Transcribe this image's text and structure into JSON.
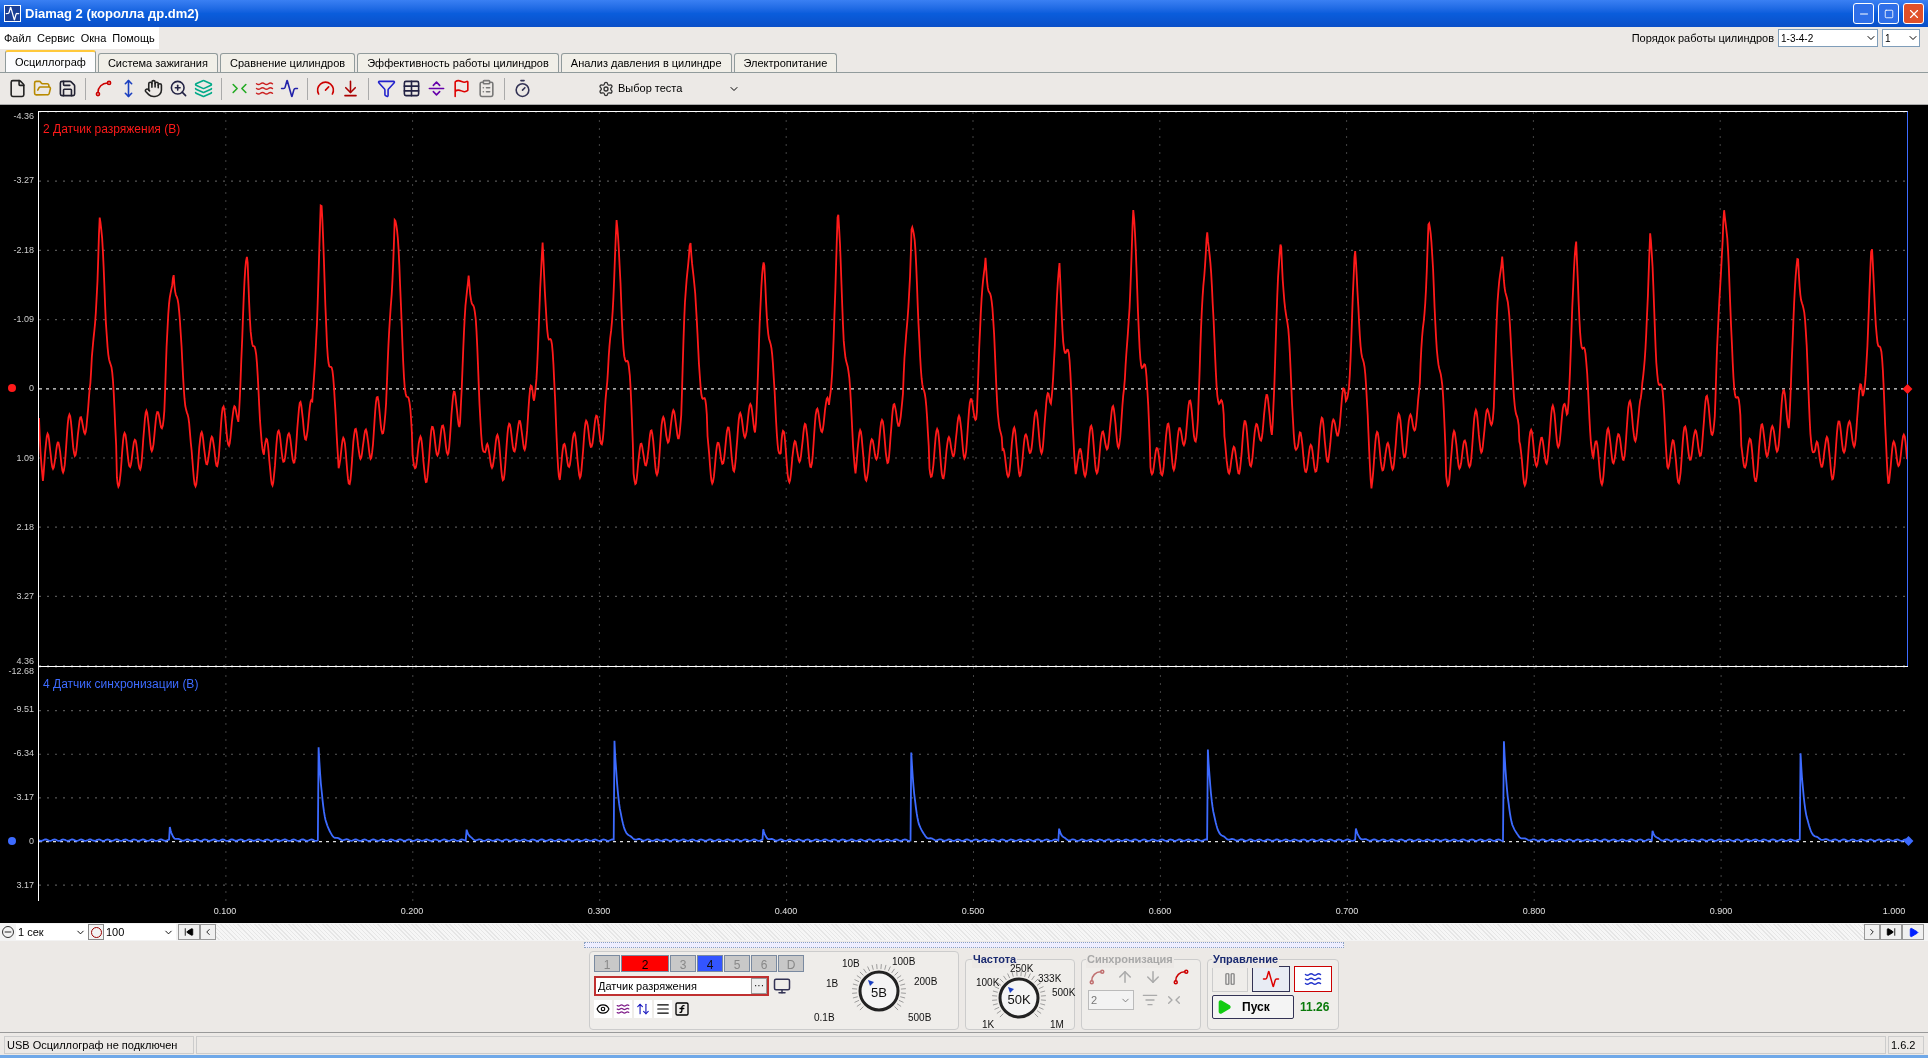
{
  "window": {
    "title": "Diamag 2 (королла др.dm2)"
  },
  "menu": [
    "Файл",
    "Сервис",
    "Окна",
    "Помощь"
  ],
  "tabs": [
    {
      "label": "Осциллограф",
      "selected": true
    },
    {
      "label": "Система зажигания",
      "selected": false
    },
    {
      "label": "Сравнение цилиндров",
      "selected": false
    },
    {
      "label": "Эффективность работы цилиндров",
      "selected": false
    },
    {
      "label": "Анализ давления в цилиндре",
      "selected": false
    },
    {
      "label": "Электропитание",
      "selected": false
    }
  ],
  "cylinder_order": {
    "label": "Порядок работы цилиндров",
    "value": "1-3-4-2",
    "cylinder": "1"
  },
  "toolbar": {
    "test_select": "Выбор теста"
  },
  "plots": [
    {
      "title": "2 Датчик разряжения (В)",
      "kind": "vacuum",
      "color": "#ff1a1a",
      "yticks": [
        "-4.36",
        "-3.27",
        "-2.18",
        "-1.09",
        "0",
        "1.09",
        "2.18",
        "3.27",
        "4.36"
      ]
    },
    {
      "title": "4 Датчик синхронизации (В)",
      "kind": "sync",
      "color": "#3d6bff",
      "yticks": [
        "-12.68",
        "-9.51",
        "-6.34",
        "-3.17",
        "0",
        "3.17"
      ]
    }
  ],
  "x_axis": [
    "0.100",
    "0.200",
    "0.300",
    "0.400",
    "0.500",
    "0.600",
    "0.700",
    "0.800",
    "0.900",
    "1.000"
  ],
  "timebase": {
    "period": "1 сек",
    "zoom": "100"
  },
  "channels": [
    {
      "label": "1",
      "on": false,
      "selected": false
    },
    {
      "label": "2",
      "on": true,
      "selected": true,
      "color": "#ff0000"
    },
    {
      "label": "3",
      "on": false,
      "selected": false
    },
    {
      "label": "4",
      "on": true,
      "selected": false,
      "color": "#3355ff"
    },
    {
      "label": "5",
      "on": false,
      "selected": false
    },
    {
      "label": "6",
      "on": false,
      "selected": false
    },
    {
      "label": "D",
      "on": false,
      "selected": false
    }
  ],
  "sensor": {
    "value": "Датчик разряжения",
    "browse": "···"
  },
  "voltage_knob": {
    "labels": [
      "0.1В",
      "1В",
      "10В",
      "100В",
      "200В",
      "500В"
    ],
    "value": "5В"
  },
  "frequency": {
    "title": "Частота",
    "labels": [
      "1K",
      "100K",
      "250K",
      "333K",
      "500K",
      "1M"
    ],
    "value": "50K"
  },
  "sync": {
    "title": "Синхронизация",
    "disabled": true,
    "value": "2"
  },
  "control": {
    "title": "Управление",
    "start": "Пуск",
    "reading": "11.26"
  },
  "status_bar": {
    "message": "USB Осциллограф не подключен",
    "version": "1.6.2"
  }
}
